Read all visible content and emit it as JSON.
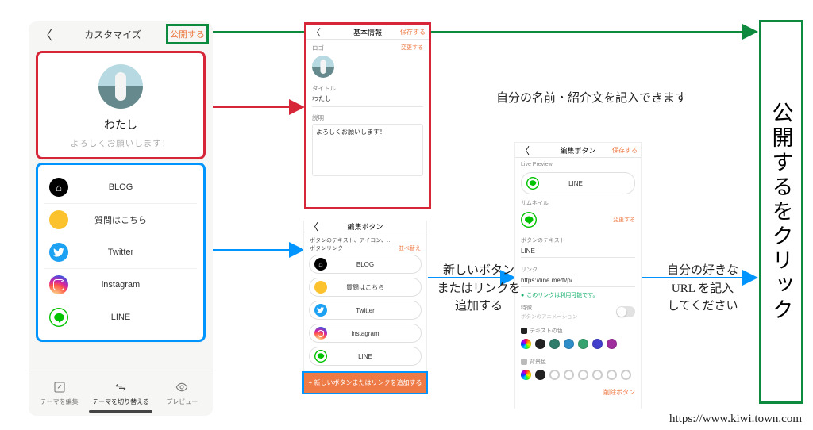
{
  "screen1": {
    "back": "〈",
    "title": "カスタマイズ",
    "publish": "公開する",
    "profile": {
      "name": "わたし",
      "bio": "よろしくお願いします！"
    },
    "links": [
      {
        "icon": "blog",
        "label": "BLOG"
      },
      {
        "icon": "q",
        "label": "質問はこちら"
      },
      {
        "icon": "tw",
        "label": "Twitter"
      },
      {
        "icon": "ig",
        "label": "instagram"
      },
      {
        "icon": "line",
        "label": "LINE"
      }
    ],
    "tabs": [
      {
        "label": "テーマを編集"
      },
      {
        "label": "テーマを切り替える"
      },
      {
        "label": "プレビュー"
      }
    ]
  },
  "screen2": {
    "title": "基本情報",
    "save": "保存する",
    "logo_label": "ロゴ",
    "change": "変更する",
    "title_field_label": "タイトル",
    "title_field_value": "わたし",
    "desc_label": "説明",
    "desc_value": "よろしくお願いします！"
  },
  "screen3": {
    "title": "編集ボタン",
    "desc": "ボタンのテキスト、アイコン、リンクを編集する…",
    "desc2": "ボタンリンク",
    "reorder": "並べ替え",
    "add": "+ 新しいボタンまたはリンクを追加する"
  },
  "screen4": {
    "title": "編集ボタン",
    "save": "保存する",
    "preview_label": "Live Preview",
    "preview_btn": "LINE",
    "thumb_label": "サムネイル",
    "thumb_change": "変更する",
    "btntext_label": "ボタンのテキスト",
    "btntext_value": "LINE",
    "link_label": "リンク",
    "link_value": "https://line.me/ti/p/",
    "link_ok": "このリンクは利用可能です。",
    "feature_label": "特徴",
    "feature_sub": "ボタンのアニメーション",
    "textcolor_label": "テキストの色",
    "bgcolor_label": "背景色",
    "delete": "削除ボタン",
    "text_swatches": [
      "rainbow",
      "#222",
      "#2f7c6a",
      "#2e8cc7",
      "#35a36f",
      "#423fcc",
      "#9f2d9d"
    ],
    "bg_swatches": [
      "rainbow",
      "#222",
      "hollow",
      "hollow",
      "hollow",
      "hollow",
      "hollow",
      "hollow"
    ]
  },
  "annotations": {
    "profile_note": "自分の名前・紹介文を記入できます",
    "add_note_l1": "新しいボタン",
    "add_note_l2": "またはリンクを",
    "add_note_l3": "追加する",
    "url_note_l1": "自分の好きな",
    "url_note_l2": "URL を記入",
    "url_note_l3": "してください",
    "big_box": "公開するをクリック",
    "footer": "https://www.kiwi.town.com"
  },
  "colors": {
    "red": "#d72638",
    "blue": "#0094ff",
    "green": "#0d8a3d",
    "orange": "#ee7a45"
  }
}
